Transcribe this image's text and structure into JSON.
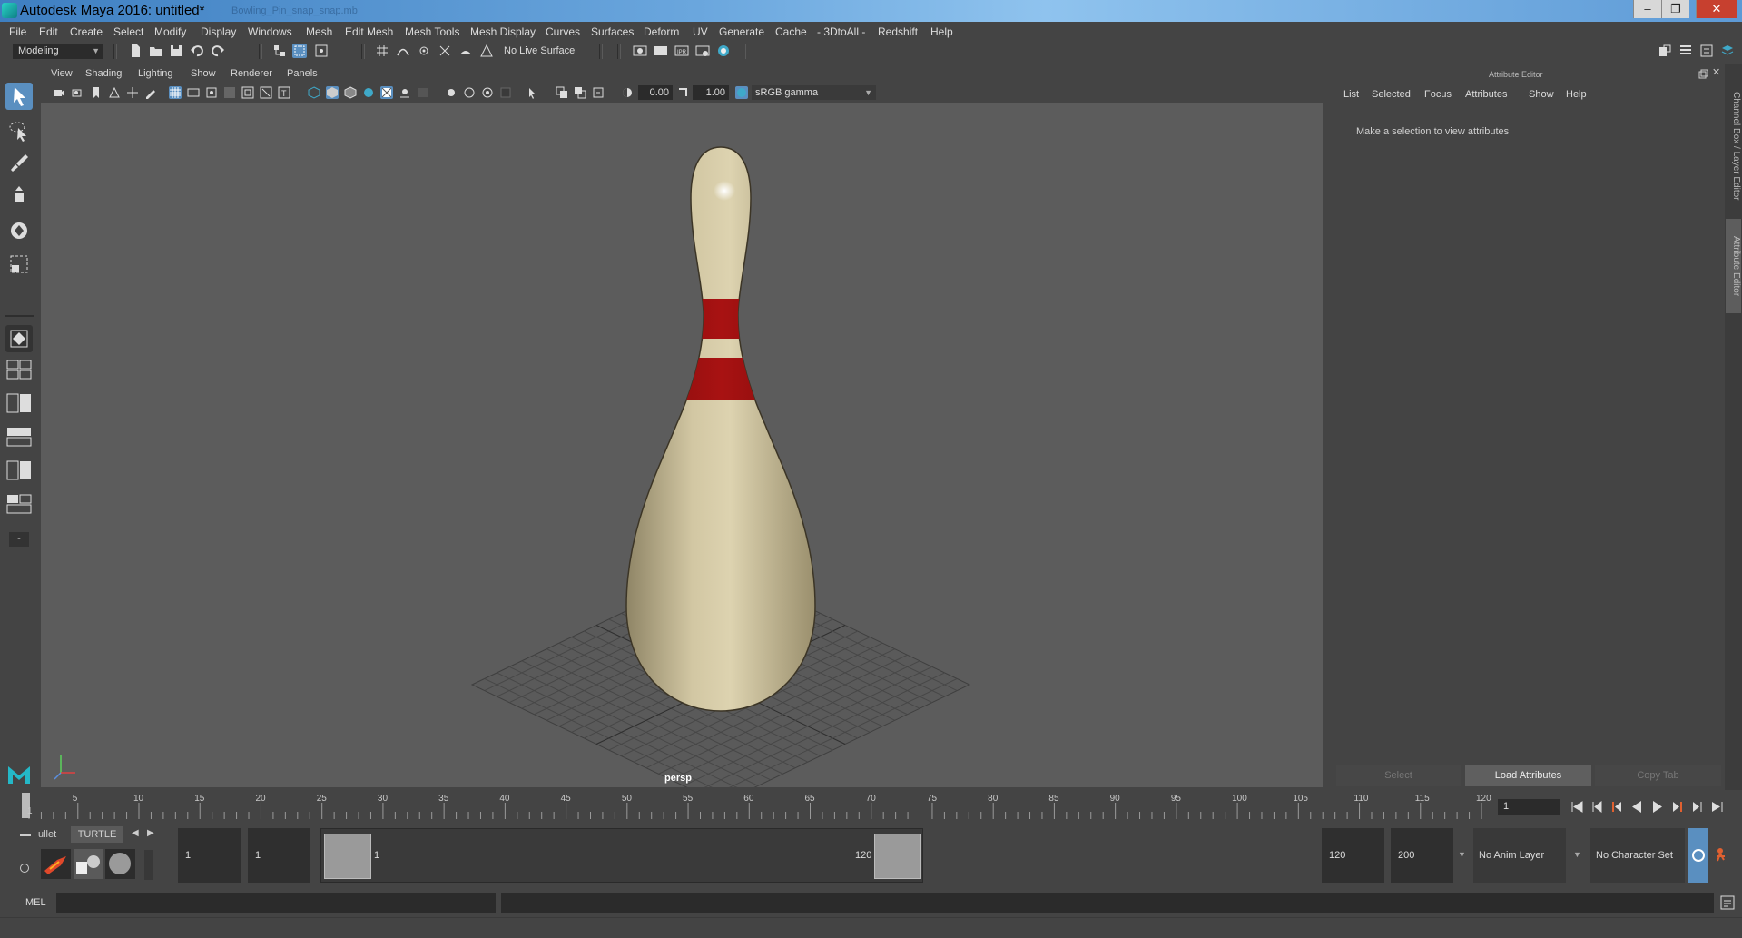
{
  "window": {
    "title": "Autodesk Maya 2016: untitled*",
    "subtitle": "Bowling_Pin_snap_snap.mb",
    "buttons": [
      "–",
      "❐",
      "✕"
    ]
  },
  "menubar": [
    "File",
    "Edit",
    "Create",
    "Select",
    "Modify",
    "Display",
    "Windows",
    "Mesh",
    "Edit Mesh",
    "Mesh Tools",
    "Mesh Display",
    "Curves",
    "Surfaces",
    "Deform",
    "UV",
    "Generate",
    "Cache",
    "- 3DtoAll -",
    "Redshift",
    "Help"
  ],
  "toolbar": {
    "mode": "Modeling",
    "live_surface": "No Live Surface",
    "icons": [
      "new-scene-icon",
      "open-scene-icon",
      "save-scene-icon",
      "undo-icon",
      "redo-icon",
      "select-hierarchy-icon",
      "select-object-icon",
      "select-component-icon",
      "snap-grid-icon",
      "snap-curve-icon",
      "snap-point-icon",
      "snap-projected-icon",
      "snap-surface-icon",
      "snap-live-icon",
      "render-view-icon",
      "render-frame-icon",
      "ipr-render-icon",
      "render-settings-icon",
      "hypershade-icon"
    ]
  },
  "panel": {
    "menus": [
      "View",
      "Shading",
      "Lighting",
      "Show",
      "Renderer",
      "Panels"
    ],
    "exposure": "0.00",
    "gamma": "1.00",
    "color_space": "sRGB gamma",
    "camera_label": "persp"
  },
  "attribute_editor": {
    "title": "Attribute Editor",
    "menus": [
      "List",
      "Selected",
      "Focus",
      "Attributes",
      "Show",
      "Help"
    ],
    "hint": "Make a selection to view attributes",
    "buttons": [
      "Select",
      "Load Attributes",
      "Copy Tab"
    ],
    "side_tabs": [
      "Channel Box / Layer Editor",
      "Attribute Editor"
    ]
  },
  "timeline": {
    "ticks": [
      "1",
      "5",
      "10",
      "15",
      "20",
      "25",
      "30",
      "35",
      "40",
      "45",
      "50",
      "55",
      "60",
      "65",
      "70",
      "75",
      "80",
      "85",
      "90",
      "95",
      "100",
      "105",
      "110",
      "115",
      "120"
    ],
    "current_frame": "1"
  },
  "range": {
    "start": "1",
    "playback_start": "1",
    "handle_start": "1",
    "handle_end": "120",
    "playback_end": "120",
    "end": "200",
    "anim_layer": "No Anim Layer",
    "character_set": "No Character Set"
  },
  "shelf": {
    "tabs": [
      "ullet",
      "TURTLE"
    ]
  },
  "cmdline": {
    "label": "MEL"
  }
}
